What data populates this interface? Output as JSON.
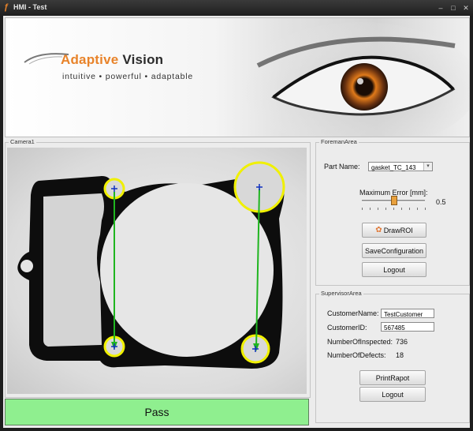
{
  "window": {
    "title": "HMI - Test",
    "minimize": "–",
    "maximize": "□",
    "close": "✕"
  },
  "banner": {
    "brand_word1": "Adaptive",
    "brand_word2": "Vision",
    "tagline": "intuitive • powerful • adaptable"
  },
  "camera": {
    "label": "Camera1",
    "result": "Pass",
    "result_color": "#8fef8f"
  },
  "foreman": {
    "label": "ForemanArea",
    "part_name_label": "Part Name:",
    "part_name_value": "gasket_TC_143",
    "max_error_label": "Maximum Error [mm]:",
    "max_error_value": "0.5",
    "max_error_fraction": 0.5,
    "draw_roi_label": "DrawROI",
    "save_config_label": "SaveConfiguration",
    "logout_label": "Logout"
  },
  "supervisor": {
    "label": "SupervisorArea",
    "customer_name_label": "CustomerName:",
    "customer_name_value": "TestCustomer",
    "customer_id_label": "CustomerID:",
    "customer_id_value": "567485",
    "inspected_label": "NumberOfInspected:",
    "inspected_value": "736",
    "defects_label": "NumberOfDefects:",
    "defects_value": "18",
    "print_label": "PrintRapot",
    "logout_label": "Logout"
  },
  "colors": {
    "accent": "#e8832a",
    "measure_line": "#1fb51f",
    "hole_marker": "#f0f000"
  }
}
